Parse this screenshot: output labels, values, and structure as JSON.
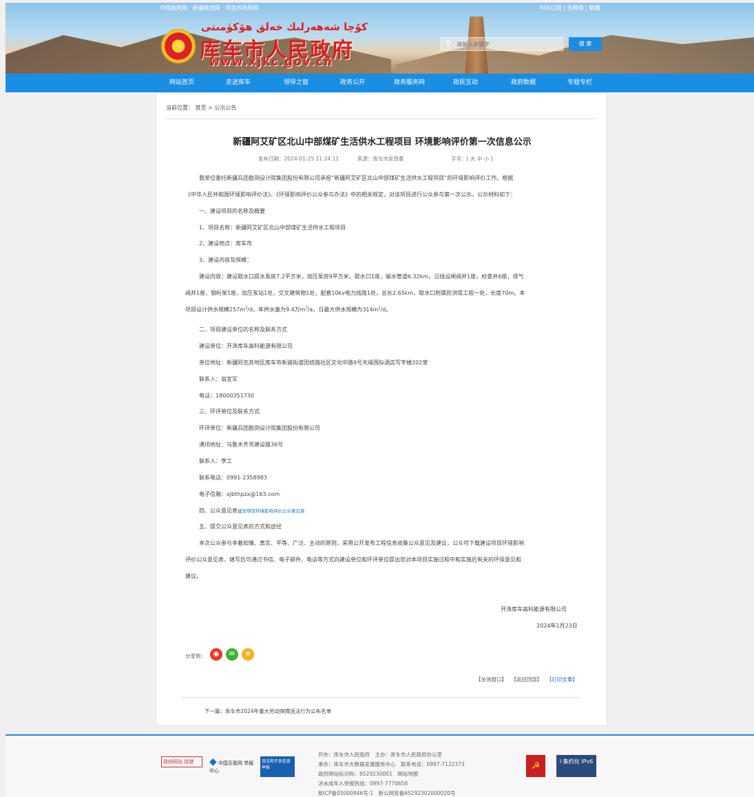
{
  "header": {
    "topline": "中国政府网 · 新疆政府网 · 阿克苏政府网",
    "toplinks": "RSS订阅 | 无障碍 | 繁體",
    "uyghur_title": "كۇچا شەھەرلىك خەلق ھۆكۈمىتى",
    "site_name": "库车市人民政府",
    "domain": "www.xjkc.gov.cn",
    "search_placeholder": "请输入关键字",
    "search_button": "搜 索"
  },
  "nav": [
    "网站首页",
    "走进库车",
    "领导之窗",
    "政务公开",
    "政务服务网",
    "政民互动",
    "政府数据",
    "专题专栏"
  ],
  "breadcrumb": "当前位置： 首页 > 公示公告",
  "article": {
    "title": "新疆阿艾矿区北山中部煤矿生活供水工程项目 环境影响评价第一次信息公示",
    "date": "发布日期：2024-01-25 11:24:11",
    "source": "来源：库车市发改委",
    "fontsize": "字号：[ 大 中 小 ]",
    "p1": "我单位委托新疆兵团勘测设计院集团股份有限公司承担“新疆阿艾矿区北山中部煤矿生活供水工程项目”的环境影响评价工作。根据",
    "p1b": "《中华人民共和国环境影响评价法》、《环境影响评价公众参与办法》中的相关规定，对该项目进行公众参与第一次公示。公示材料如下：",
    "s1": "一、建设项目的名称及概要",
    "s1a": "1、项目名称：新疆阿艾矿区北山中部煤矿生活供水工程项目",
    "s1b": "2、建设地点：库车市",
    "s1c": "3、建设内容及规模：",
    "p2": "建设内容：建设取水口提水泵房7.2平方米，加压泵房9平方米，取水口1座，输水管道6.32km，沿线设闸阀井1座，检查井6座，排气",
    "p2b": "阀井1座，钢桁架1座，加压泵站1处，交叉建筑物1处，配套10kv电力线路1处，总长2.65km，取水口附属防洪堤工程一处，长度70m。本",
    "p2c_pre": "项目设计供水规模257m",
    "p2c_mid": "/d，年供水量为9.4万m",
    "p2c_mid2": "/a，日最大供水规模为314m",
    "p2c_end": "/d。",
    "sup3": "3",
    "s2": "二、项目建设单位的名称及联系方式",
    "s2a": "建设单位：开洙库车高科能源有限公司",
    "s2b": "单位地址：新疆阿克苏地区库车市新城街道团结路社区文化中路9号天缘国际酒店写字楼202室",
    "s2c": "联系人：翁宜军",
    "s2d": "电话：18000351730",
    "s3": "三、环评单位及联系方式",
    "s3a": "环评单位：新疆兵团勘测设计院集团股份有限公司",
    "s3b": "通讯地址：乌鲁木齐市建设路36号",
    "s3c": "联系人：李工",
    "s3d": "联系电话：0991-2358983",
    "s3e": "电子信箱：xjbthpzx@163.com",
    "s4": "四、公众意见表",
    "s4link": "建设项目环境影响评价公众意见表",
    "s5": "五、提交公众意见表的方式和途径",
    "p3": "本次公众参与本着知情、真实、平等、广泛、主动的原则，采用公开发布工程信息收集公众意见及建议，公众可下载建设项目环境影响",
    "p3b": "评价公众意见表，填写后可通过书信、电子邮件、电话等方式向建设单位和环评单位提出您对本项目实施过程中和实施后有关的环保意见和",
    "p3c": "建议。",
    "sign": "开洙库车高科能源有限公司",
    "sign_date": "2024年1月23日"
  },
  "share_label": "分享到：",
  "share_icons": [
    "weibo-icon",
    "wechat-icon",
    "qzone-icon"
  ],
  "actions": [
    "【关闭窗口】",
    "【返回顶部】",
    "【打印文章】"
  ],
  "next": "下一篇：库车市2024年重大劳动保障违法行为公布名单",
  "footer": {
    "logo1": "政府网站 找错",
    "logo2": "中国互联网 举报中心",
    "logo3": "违法和不良信息举报",
    "l1": "开办：库车市人民政府　主办：库车市人民政府办公室",
    "l2": "承办：库车市大数据发展服务中心　联系电话：0997-7122373",
    "l3": "政府网站标识码：6529230001　网站地图",
    "l4": "涉未成年人举报热线：0997-7770658",
    "l5": "新ICP备05000846号-1　新公网安备65292302000020号",
    "badge_right": "I·集约化 IPv6"
  },
  "colors": {
    "nav": "#1a8ee2",
    "title_red": "#d8201e"
  }
}
